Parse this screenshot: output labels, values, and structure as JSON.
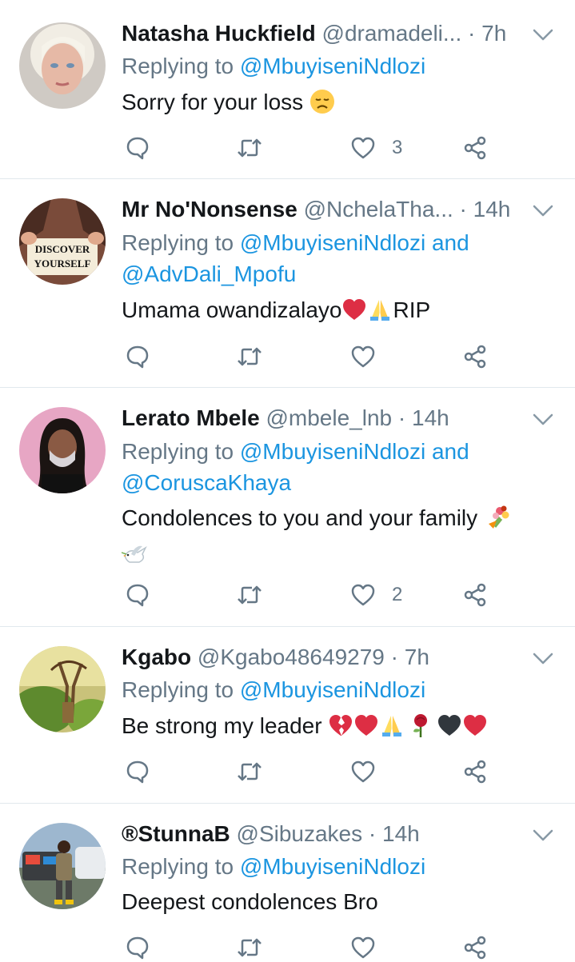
{
  "tweets": [
    {
      "name": "Natasha Huckfield",
      "handle": "@dramadeli...",
      "dot": "·",
      "time": "7h",
      "replying_prefix": "Replying to ",
      "mentions": [
        "@MbuyiseniNdlozi"
      ],
      "mention_joiner": "",
      "text": "Sorry for your loss",
      "emojis": [
        "disappointed-face"
      ],
      "likes": "3"
    },
    {
      "name": "Mr No'Nonsense",
      "handle": "@NchelaTha...",
      "dot": "·",
      "time": "14h",
      "replying_prefix": "Replying to ",
      "mentions": [
        "@MbuyiseniNdlozi",
        "@AdvDali_Mpofu"
      ],
      "mention_joiner": " and",
      "text": "Umama owandizalayo",
      "text_suffix": "RIP",
      "avatar_text": [
        "DISCOVER",
        "YOURSELF"
      ],
      "emojis": [
        "red-heart",
        "folded-hands"
      ],
      "likes": ""
    },
    {
      "name": "Lerato Mbele",
      "handle": "@mbele_lnb",
      "dot": "·",
      "time": "14h",
      "replying_prefix": "Replying to ",
      "mentions": [
        "@MbuyiseniNdlozi",
        "@CoruscaKhaya"
      ],
      "mention_joiner": " and",
      "text": "Condolences to you and your family",
      "emojis": [
        "bouquet",
        "dove"
      ],
      "likes": "2"
    },
    {
      "name": "Kgabo",
      "handle": "@Kgabo48649279",
      "dot": "·",
      "time": "7h",
      "replying_prefix": "Replying to ",
      "mentions": [
        "@MbuyiseniNdlozi"
      ],
      "mention_joiner": "",
      "text": "Be strong my leader",
      "emojis": [
        "broken-heart",
        "red-heart",
        "folded-hands",
        "rose",
        "black-heart",
        "red-heart"
      ],
      "likes": ""
    },
    {
      "name": "®StunnaB",
      "handle": "@Sibuzakes",
      "dot": "·",
      "time": "14h",
      "replying_prefix": "Replying to ",
      "mentions": [
        "@MbuyiseniNdlozi"
      ],
      "mention_joiner": "",
      "text": "Deepest condolences Bro",
      "emojis": [],
      "likes": ""
    }
  ],
  "colors": {
    "text": "#14171a",
    "secondary": "#657786",
    "mention": "#1b95e0",
    "divider": "#e1e8ed"
  },
  "icons": {
    "reply": "reply-icon",
    "retweet": "retweet-icon",
    "like": "heart-icon",
    "share": "share-icon",
    "menu": "chevron-down-icon"
  }
}
